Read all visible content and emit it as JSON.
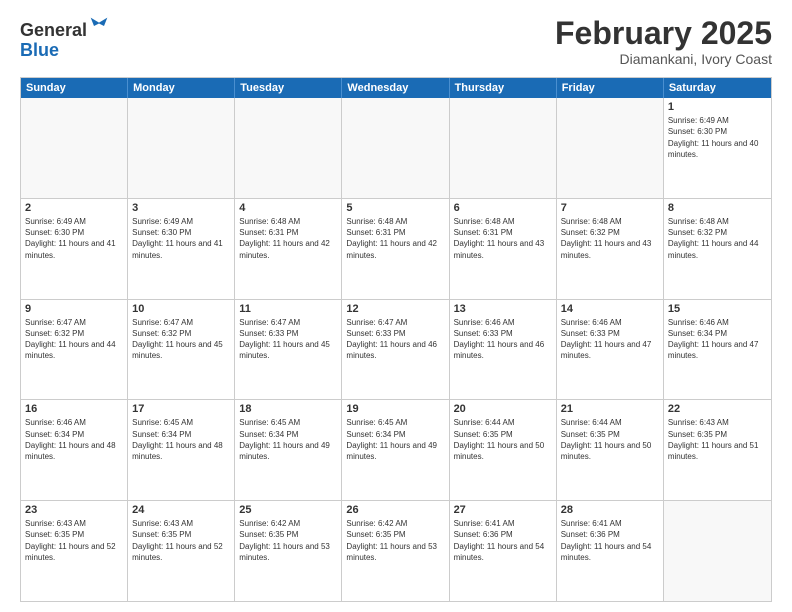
{
  "header": {
    "logo_line1": "General",
    "logo_line2": "Blue",
    "month": "February 2025",
    "location": "Diamankani, Ivory Coast"
  },
  "days_of_week": [
    "Sunday",
    "Monday",
    "Tuesday",
    "Wednesday",
    "Thursday",
    "Friday",
    "Saturday"
  ],
  "rows": [
    [
      {
        "day": "",
        "info": ""
      },
      {
        "day": "",
        "info": ""
      },
      {
        "day": "",
        "info": ""
      },
      {
        "day": "",
        "info": ""
      },
      {
        "day": "",
        "info": ""
      },
      {
        "day": "",
        "info": ""
      },
      {
        "day": "1",
        "info": "Sunrise: 6:49 AM\nSunset: 6:30 PM\nDaylight: 11 hours and 40 minutes."
      }
    ],
    [
      {
        "day": "2",
        "info": "Sunrise: 6:49 AM\nSunset: 6:30 PM\nDaylight: 11 hours and 41 minutes."
      },
      {
        "day": "3",
        "info": "Sunrise: 6:49 AM\nSunset: 6:30 PM\nDaylight: 11 hours and 41 minutes."
      },
      {
        "day": "4",
        "info": "Sunrise: 6:48 AM\nSunset: 6:31 PM\nDaylight: 11 hours and 42 minutes."
      },
      {
        "day": "5",
        "info": "Sunrise: 6:48 AM\nSunset: 6:31 PM\nDaylight: 11 hours and 42 minutes."
      },
      {
        "day": "6",
        "info": "Sunrise: 6:48 AM\nSunset: 6:31 PM\nDaylight: 11 hours and 43 minutes."
      },
      {
        "day": "7",
        "info": "Sunrise: 6:48 AM\nSunset: 6:32 PM\nDaylight: 11 hours and 43 minutes."
      },
      {
        "day": "8",
        "info": "Sunrise: 6:48 AM\nSunset: 6:32 PM\nDaylight: 11 hours and 44 minutes."
      }
    ],
    [
      {
        "day": "9",
        "info": "Sunrise: 6:47 AM\nSunset: 6:32 PM\nDaylight: 11 hours and 44 minutes."
      },
      {
        "day": "10",
        "info": "Sunrise: 6:47 AM\nSunset: 6:32 PM\nDaylight: 11 hours and 45 minutes."
      },
      {
        "day": "11",
        "info": "Sunrise: 6:47 AM\nSunset: 6:33 PM\nDaylight: 11 hours and 45 minutes."
      },
      {
        "day": "12",
        "info": "Sunrise: 6:47 AM\nSunset: 6:33 PM\nDaylight: 11 hours and 46 minutes."
      },
      {
        "day": "13",
        "info": "Sunrise: 6:46 AM\nSunset: 6:33 PM\nDaylight: 11 hours and 46 minutes."
      },
      {
        "day": "14",
        "info": "Sunrise: 6:46 AM\nSunset: 6:33 PM\nDaylight: 11 hours and 47 minutes."
      },
      {
        "day": "15",
        "info": "Sunrise: 6:46 AM\nSunset: 6:34 PM\nDaylight: 11 hours and 47 minutes."
      }
    ],
    [
      {
        "day": "16",
        "info": "Sunrise: 6:46 AM\nSunset: 6:34 PM\nDaylight: 11 hours and 48 minutes."
      },
      {
        "day": "17",
        "info": "Sunrise: 6:45 AM\nSunset: 6:34 PM\nDaylight: 11 hours and 48 minutes."
      },
      {
        "day": "18",
        "info": "Sunrise: 6:45 AM\nSunset: 6:34 PM\nDaylight: 11 hours and 49 minutes."
      },
      {
        "day": "19",
        "info": "Sunrise: 6:45 AM\nSunset: 6:34 PM\nDaylight: 11 hours and 49 minutes."
      },
      {
        "day": "20",
        "info": "Sunrise: 6:44 AM\nSunset: 6:35 PM\nDaylight: 11 hours and 50 minutes."
      },
      {
        "day": "21",
        "info": "Sunrise: 6:44 AM\nSunset: 6:35 PM\nDaylight: 11 hours and 50 minutes."
      },
      {
        "day": "22",
        "info": "Sunrise: 6:43 AM\nSunset: 6:35 PM\nDaylight: 11 hours and 51 minutes."
      }
    ],
    [
      {
        "day": "23",
        "info": "Sunrise: 6:43 AM\nSunset: 6:35 PM\nDaylight: 11 hours and 52 minutes."
      },
      {
        "day": "24",
        "info": "Sunrise: 6:43 AM\nSunset: 6:35 PM\nDaylight: 11 hours and 52 minutes."
      },
      {
        "day": "25",
        "info": "Sunrise: 6:42 AM\nSunset: 6:35 PM\nDaylight: 11 hours and 53 minutes."
      },
      {
        "day": "26",
        "info": "Sunrise: 6:42 AM\nSunset: 6:35 PM\nDaylight: 11 hours and 53 minutes."
      },
      {
        "day": "27",
        "info": "Sunrise: 6:41 AM\nSunset: 6:36 PM\nDaylight: 11 hours and 54 minutes."
      },
      {
        "day": "28",
        "info": "Sunrise: 6:41 AM\nSunset: 6:36 PM\nDaylight: 11 hours and 54 minutes."
      },
      {
        "day": "",
        "info": ""
      }
    ]
  ]
}
